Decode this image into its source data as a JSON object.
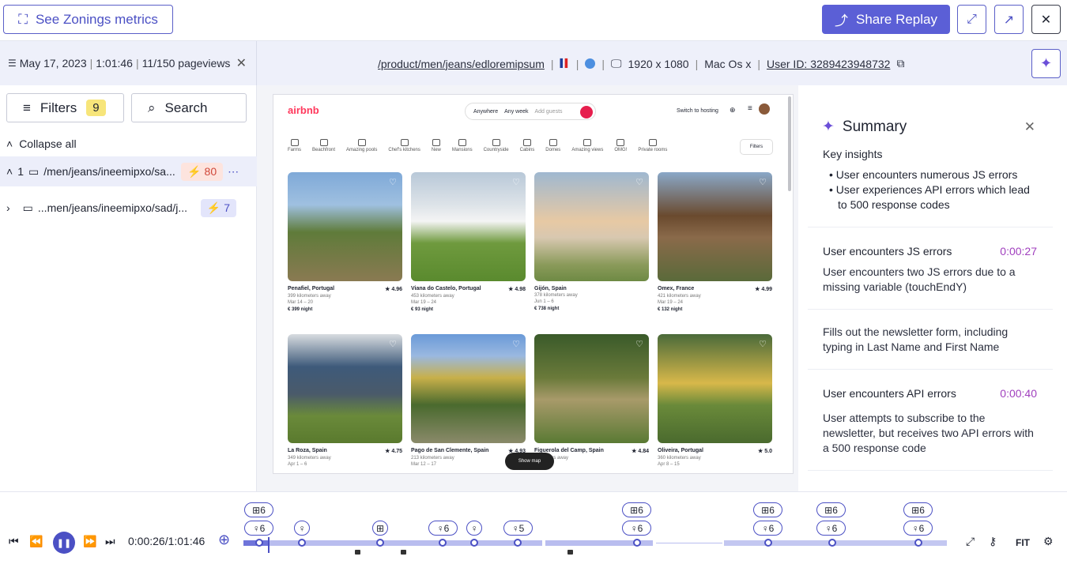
{
  "topbar": {
    "zoning_label": "See Zonings metrics",
    "share_label": "Share Replay"
  },
  "session": {
    "date": "May 17, 2023",
    "duration": "1:01:46",
    "pageviews": "11/150 pageviews"
  },
  "pageinfo": {
    "url": "/product/men/jeans/edloremipsum",
    "resolution": "1920 x 1080",
    "os": "Mac Os x",
    "user_id": "User ID: 3289423948732"
  },
  "leftpanel": {
    "filters_label": "Filters",
    "filters_count": "9",
    "search_label": "Search",
    "collapse_label": "Collapse all",
    "pageviews": [
      {
        "index": "1",
        "path": "/men/jeans/ineemipxo/sa...",
        "count": "80",
        "type": "error"
      },
      {
        "index": "",
        "path": "...men/jeans/ineemipxo/sad/j...",
        "count": "7",
        "type": "normal"
      }
    ]
  },
  "airbnb": {
    "logo": "airbnb",
    "search": {
      "where": "Anywhere",
      "when": "Any week",
      "who": "Add guests"
    },
    "hosting": "Switch to hosting",
    "categories": [
      "Farms",
      "Beachfront",
      "Amazing pools",
      "Chef's kitchens",
      "New",
      "Mansions",
      "Countryside",
      "Cabins",
      "Domes",
      "Amazing views",
      "OMG!",
      "Private rooms"
    ],
    "filters": "Filters",
    "show_map": "Show map",
    "listings": [
      {
        "place": "Penafiel, Portugal",
        "rating": "★ 4.96",
        "dist": "399 kilometers away",
        "dates": "Mar 14 – 20",
        "price": "€ 399 night"
      },
      {
        "place": "Viana do Castelo, Portugal",
        "rating": "★ 4.98",
        "dist": "453 kilometers away",
        "dates": "Mar 19 – 24",
        "price": "€ 93 night"
      },
      {
        "place": "Gijón, Spain",
        "rating": "",
        "dist": "378 kilometers away",
        "dates": "Jun 1 – 6",
        "price": "€ 738 night"
      },
      {
        "place": "Omex, France",
        "rating": "★ 4.99",
        "dist": "421 kilometers away",
        "dates": "Mar 19 – 24",
        "price": "€ 132 night"
      },
      {
        "place": "La Roza, Spain",
        "rating": "★ 4.75",
        "dist": "349 kilometers away",
        "dates": "Apr 1 – 6",
        "price": ""
      },
      {
        "place": "Pago de San Clemente, Spain",
        "rating": "★ 4.93",
        "dist": "213 kilometers away",
        "dates": "Mar 12 – 17",
        "price": ""
      },
      {
        "place": "Figuerola del Camp, Spain",
        "rating": "★ 4.84",
        "dist": "kilometers away",
        "dates": "17",
        "price": ""
      },
      {
        "place": "Oliveira, Portugal",
        "rating": "★ 5.0",
        "dist": "360 kilometers away",
        "dates": "Apr 8 – 15",
        "price": ""
      }
    ]
  },
  "summary": {
    "title": "Summary",
    "key_title": "Key insights",
    "insights": [
      "User encounters numerous JS errors",
      "User experiences API errors which lead to 500 response codes"
    ],
    "events": [
      {
        "title": "User encounters JS errors",
        "time": "0:00:27",
        "body": "User encounters two JS errors due to a missing variable (touchEndY)"
      },
      {
        "title": "",
        "time": "",
        "body": "Fills out the newsletter form, including typing in Last Name and First Name"
      },
      {
        "title": "User encounters API errors",
        "time": "0:00:40",
        "body": "User attempts to subscribe to the newsletter, but receives two API errors with a 500 response code"
      }
    ]
  },
  "player": {
    "time": "0:00:26/1:01:46",
    "fit_label": "FIT",
    "tags": {
      "six": "6",
      "five": "5"
    }
  }
}
